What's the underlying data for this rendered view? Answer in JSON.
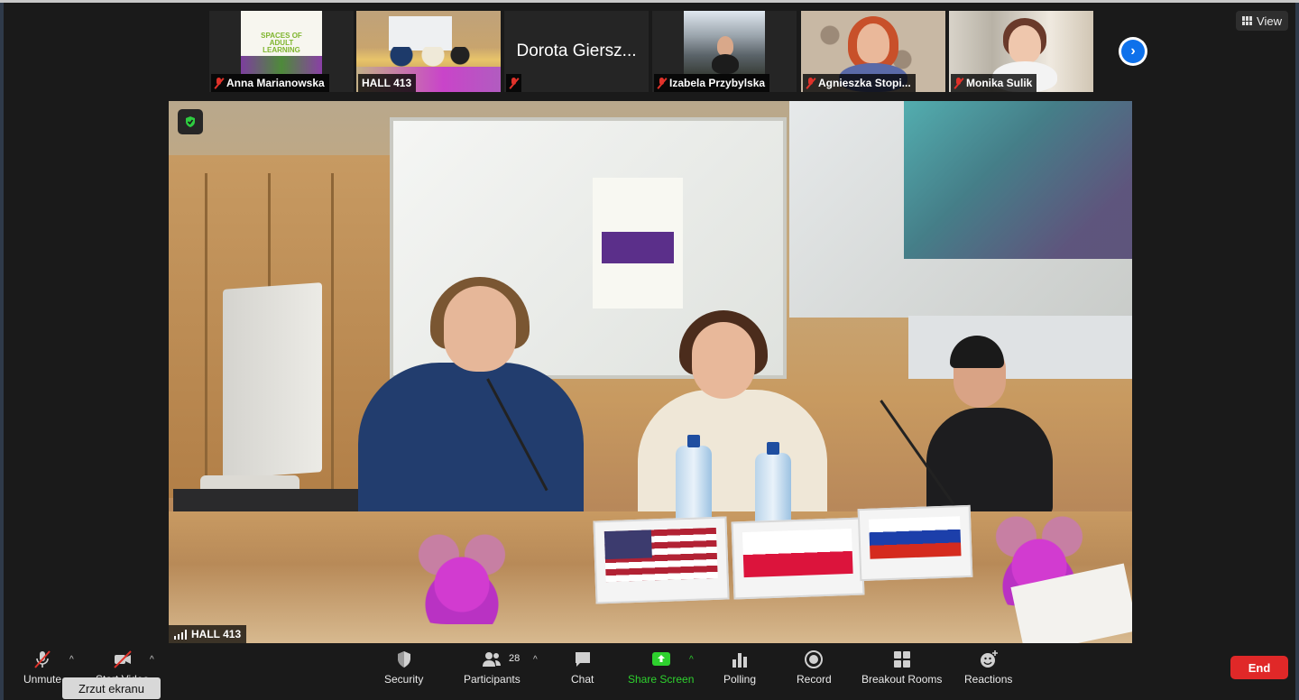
{
  "view_button": {
    "label": "View"
  },
  "thumbnails": [
    {
      "name": "Anna Marianowska",
      "poster_text": "SPACES OF ADULT LEARNING"
    },
    {
      "name": "HALL 413"
    },
    {
      "name": "Dorota Giersz..."
    },
    {
      "name": "Izabela Przybylska"
    },
    {
      "name": "Agnieszka Stopi..."
    },
    {
      "name": "Monika Sulik"
    }
  ],
  "main_video": {
    "speaker_label": "HALL 413"
  },
  "toolbar": {
    "unmute": "Unmute",
    "start_video": "Start Video",
    "security": "Security",
    "participants": "Participants",
    "participants_count": "28",
    "chat": "Chat",
    "share_screen": "Share Screen",
    "polling": "Polling",
    "record": "Record",
    "breakout_rooms": "Breakout Rooms",
    "reactions": "Reactions",
    "end": "End"
  },
  "tooltip": {
    "text": "Zrzut ekranu"
  },
  "colors": {
    "accent_blue": "#0e71eb",
    "end_red": "#e02828",
    "share_green": "#2ed12e",
    "active_border": "#a9d45a"
  }
}
